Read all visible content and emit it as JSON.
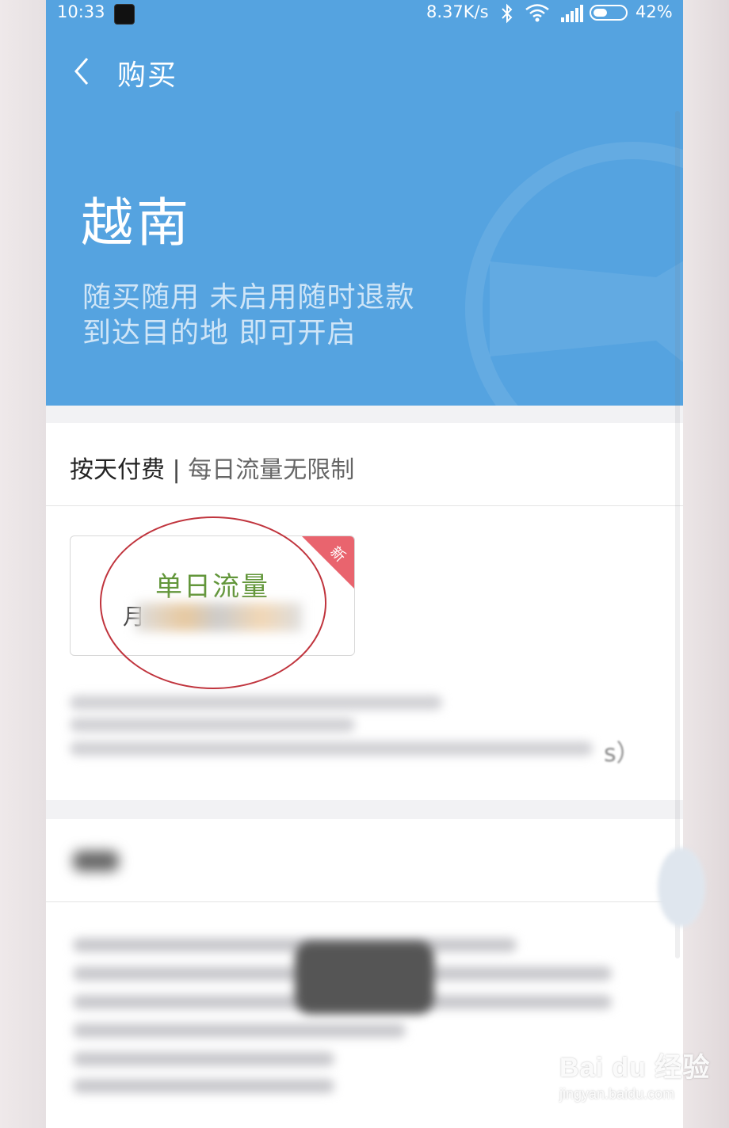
{
  "status_bar": {
    "time": "10:33",
    "net_speed": "8.37K/s",
    "battery_percent": "42%",
    "battery_level": 0.42,
    "icons": [
      "notification-app-icon",
      "bluetooth-icon",
      "wifi-icon",
      "signal-icon",
      "battery-icon"
    ]
  },
  "header": {
    "back_icon": "chevron-left-icon",
    "title": "购买",
    "country": "越南",
    "slogan_line1": "随买随用 未启用随时退款",
    "slogan_line2": "到达目的地 即可开启",
    "decoration_icon": "airplane-icon",
    "background_color": "#55a3e0"
  },
  "plan_section": {
    "heading_main": "按天付费",
    "heading_separator": "|",
    "heading_sub": "每日流量无限制",
    "plan_card": {
      "badge": "新",
      "badge_color": "#e9646e",
      "name": "单日流量",
      "name_color": "#62963a",
      "price_visible_prefix": "月"
    },
    "description_tail": "s）"
  },
  "watermark": {
    "brand": "Bai du 经验",
    "url": "jingyan.baidu.com"
  }
}
